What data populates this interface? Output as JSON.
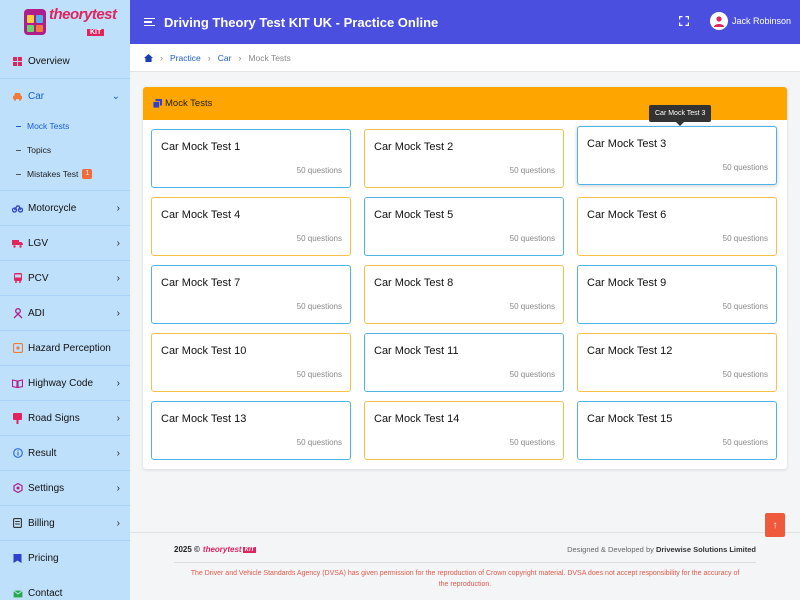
{
  "header": {
    "title": "Driving Theory Test KIT UK - Practice Online",
    "user_name": "Jack Robinson"
  },
  "logo": {
    "text": "theorytest",
    "kit": "KIT"
  },
  "sidebar": {
    "overview": "Overview",
    "car": "Car",
    "car_sub": [
      {
        "label": "Mock Tests"
      },
      {
        "label": "Topics"
      },
      {
        "label": "Mistakes Test",
        "badge": "1"
      }
    ],
    "items": [
      {
        "label": "Motorcycle"
      },
      {
        "label": "LGV"
      },
      {
        "label": "PCV"
      },
      {
        "label": "ADI"
      },
      {
        "label": "Hazard Perception"
      },
      {
        "label": "Highway Code"
      },
      {
        "label": "Road Signs"
      },
      {
        "label": "Result"
      },
      {
        "label": "Settings"
      },
      {
        "label": "Billing"
      },
      {
        "label": "Pricing"
      },
      {
        "label": "Contact"
      }
    ]
  },
  "breadcrumb": {
    "practice": "Practice",
    "car": "Car",
    "current": "Mock Tests"
  },
  "panel": {
    "title": "Mock Tests",
    "tooltip": "Car Mock Test 3",
    "tests": [
      {
        "title": "Car Mock Test 1",
        "questions": "50 questions"
      },
      {
        "title": "Car Mock Test 2",
        "questions": "50 questions"
      },
      {
        "title": "Car Mock Test 3",
        "questions": "50 questions"
      },
      {
        "title": "Car Mock Test 4",
        "questions": "50 questions"
      },
      {
        "title": "Car Mock Test 5",
        "questions": "50 questions"
      },
      {
        "title": "Car Mock Test 6",
        "questions": "50 questions"
      },
      {
        "title": "Car Mock Test 7",
        "questions": "50 questions"
      },
      {
        "title": "Car Mock Test 8",
        "questions": "50 questions"
      },
      {
        "title": "Car Mock Test 9",
        "questions": "50 questions"
      },
      {
        "title": "Car Mock Test 10",
        "questions": "50 questions"
      },
      {
        "title": "Car Mock Test 11",
        "questions": "50 questions"
      },
      {
        "title": "Car Mock Test 12",
        "questions": "50 questions"
      },
      {
        "title": "Car Mock Test 13",
        "questions": "50 questions"
      },
      {
        "title": "Car Mock Test 14",
        "questions": "50 questions"
      },
      {
        "title": "Car Mock Test 15",
        "questions": "50 questions"
      }
    ]
  },
  "footer": {
    "year": "2025 ©",
    "brand": "theorytest",
    "brand_kit": "KIT",
    "designed_by": "Designed & Developed by",
    "company": "Drivewise Solutions Limited",
    "note": "The Driver and Vehicle Standards Agency (DVSA) has given permission for the reproduction of Crown copyright material. DVSA does not accept responsibility for the accuracy of the reproduction."
  },
  "colors": {
    "header": "#4a4fdf",
    "sidebar": "#bfe0fb",
    "panel_head": "#ffa500",
    "card_blue": "#4fb3e8",
    "card_orange": "#f7c04a",
    "accent_red": "#e0245e",
    "scroll_top": "#f05a3c"
  }
}
